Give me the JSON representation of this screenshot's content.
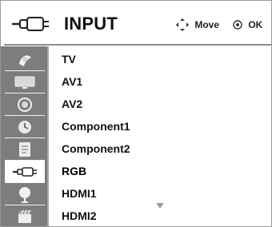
{
  "header": {
    "title": "INPUT",
    "move_label": "Move",
    "ok_label": "OK"
  },
  "sidebar": {
    "icons": [
      "picture-icon",
      "tv-icon",
      "speaker-icon",
      "clock-icon",
      "document-icon",
      "plug-icon",
      "lock-icon",
      "clapper-icon"
    ],
    "active_index": 5
  },
  "menu": {
    "items": [
      "TV",
      "AV1",
      "AV2",
      "Component1",
      "Component2",
      "RGB",
      "HDMI1",
      "HDMI2"
    ],
    "selected_index": 5
  },
  "colors": {
    "sidebar": "#7d7d7d",
    "text": "#111111",
    "divider": "#8c8c8c"
  }
}
